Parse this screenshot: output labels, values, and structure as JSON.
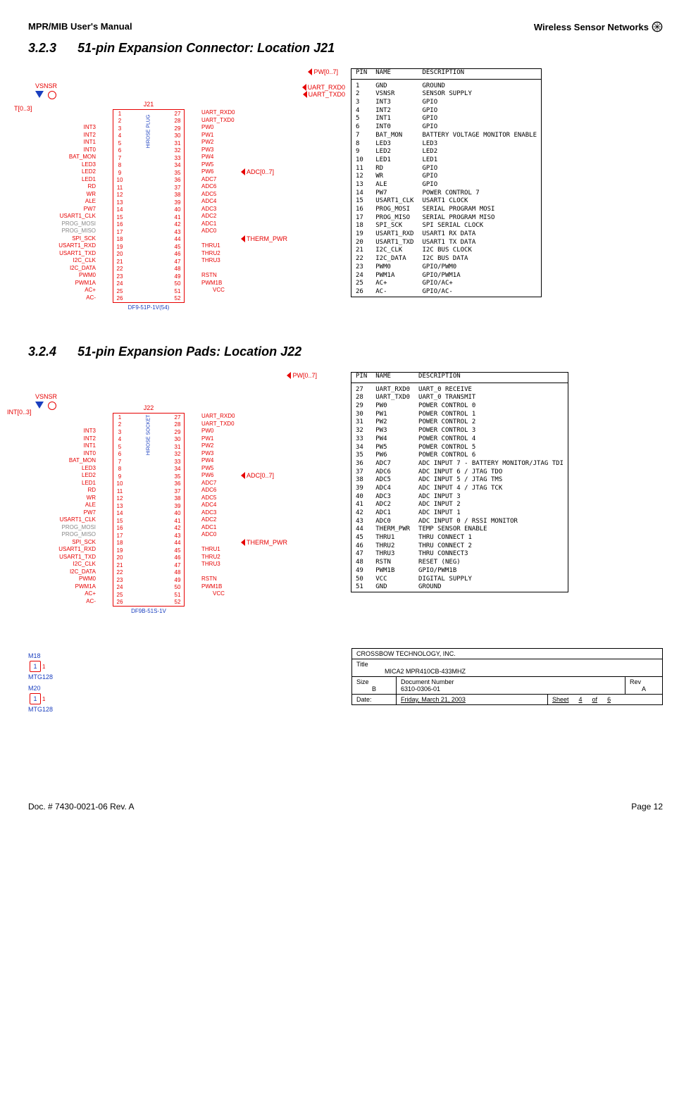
{
  "header": {
    "left": "MPR/MIB User's Manual",
    "right": "Wireless Sensor Networks"
  },
  "sections": {
    "s1": {
      "num": "3.2.3",
      "title": "51-pin Expansion Connector: Location J21"
    },
    "s2": {
      "num": "3.2.4",
      "title": "51-pin Expansion Pads: Location J22"
    }
  },
  "conn1": {
    "ref": "J21",
    "part": "DF9-51P-1V(54)",
    "mid_label": "HIROSE  PLUG",
    "vsnsr": "VSNSR",
    "left_bus": "T[0..3]",
    "top_bus": "PW[0..7]",
    "right_bus": "ADC[0..7]",
    "uart_rx": "UART_RXD0",
    "uart_tx": "UART_TXD0",
    "vcc": "VCC",
    "left": [
      "",
      "",
      "INT3",
      "INT2",
      "INT1",
      "INT0",
      "BAT_MON",
      "LED3",
      "LED2",
      "LED1",
      "RD",
      "WR",
      "ALE",
      "PW7",
      "USART1_CLK",
      "PROG_MOSI",
      "PROG_MISO",
      "SPI_SCK",
      "USART1_RXD",
      "USART1_TXD",
      "I2C_CLK",
      "I2C_DATA",
      "PWM0",
      "PWM1A",
      "AC+",
      "AC-"
    ],
    "right": [
      "UART_RXD0",
      "UART_TXD0",
      "PW0",
      "PW1",
      "PW2",
      "PW3",
      "PW4",
      "PW5",
      "PW6",
      "ADC7",
      "ADC6",
      "ADC5",
      "ADC4",
      "ADC3",
      "ADC2",
      "ADC1",
      "ADC0",
      "",
      "THRU1",
      "THRU2",
      "THRU3",
      "",
      "RSTN",
      "PWM1B",
      ""
    ],
    "therm": "THERM_PWR"
  },
  "conn2": {
    "ref": "J22",
    "part": "DF9B-51S-1V",
    "mid_label": "HIROSE  SOCKET",
    "vsnsr": "VSNSR",
    "left_bus": "INT[0..3]",
    "top_bus": "PW[0..7]",
    "right_bus": "ADC[0..7]",
    "uart_rx": "UART_RXD0",
    "uart_tx": "UART_TXD0",
    "vcc": "VCC",
    "left": [
      "",
      "",
      "INT3",
      "INT2",
      "INT1",
      "INT0",
      "BAT_MON",
      "LED3",
      "LED2",
      "LED1",
      "RD",
      "WR",
      "ALE",
      "PW7",
      "USART1_CLK",
      "PROG_MOSI",
      "PROG_MISO",
      "SPI_SCK",
      "USART1_RXD",
      "USART1_TXD",
      "I2C_CLK",
      "I2C_DATA",
      "PWM0",
      "PWM1A",
      "AC+",
      "AC-"
    ],
    "right": [
      "UART_RXD0",
      "UART_TXD0",
      "PW0",
      "PW1",
      "PW2",
      "PW3",
      "PW4",
      "PW5",
      "PW6",
      "ADC7",
      "ADC6",
      "ADC5",
      "ADC4",
      "ADC3",
      "ADC2",
      "ADC1",
      "ADC0",
      "",
      "THRU1",
      "THRU2",
      "THRU3",
      "",
      "RSTN",
      "PWM1B",
      ""
    ],
    "therm": "THERM_PWR"
  },
  "pins1": {
    "h": [
      "PIN",
      "NAME",
      "DESCRIPTION"
    ],
    "rows": [
      [
        "1",
        "GND",
        "GROUND"
      ],
      [
        "2",
        "VSNSR",
        "SENSOR SUPPLY"
      ],
      [
        "3",
        "INT3",
        "GPIO"
      ],
      [
        "4",
        "INT2",
        "GPIO"
      ],
      [
        "5",
        "INT1",
        "GPIO"
      ],
      [
        "6",
        "INT0",
        "GPIO"
      ],
      [
        "7",
        "BAT_MON",
        "BATTERY VOLTAGE MONITOR ENABLE"
      ],
      [
        "8",
        "LED3",
        "LED3"
      ],
      [
        "9",
        "LED2",
        "LED2"
      ],
      [
        "10",
        "LED1",
        "LED1"
      ],
      [
        "11",
        "RD",
        "GPIO"
      ],
      [
        "12",
        "WR",
        "GPIO"
      ],
      [
        "13",
        "ALE",
        "GPIO"
      ],
      [
        "14",
        "PW7",
        "POWER CONTROL 7"
      ],
      [
        "15",
        "USART1_CLK",
        "USART1  CLOCK"
      ],
      [
        "16",
        "PROG_MOSI",
        "SERIAL PROGRAM MOSI"
      ],
      [
        "17",
        "PROG_MISO",
        "SERIAL PROGRAM MISO"
      ],
      [
        "18",
        "SPI_SCK",
        "SPI SERIAL CLOCK"
      ],
      [
        "19",
        "USART1_RXD",
        "USART1 RX DATA"
      ],
      [
        "20",
        "USART1_TXD",
        "USART1 TX DATA"
      ],
      [
        "21",
        "I2C_CLK",
        "I2C BUS CLOCK"
      ],
      [
        "22",
        "I2C_DATA",
        "I2C BUS DATA"
      ],
      [
        "23",
        "PWM0",
        "GPIO/PWM0"
      ],
      [
        "24",
        "PWM1A",
        "GPIO/PWM1A"
      ],
      [
        "25",
        "AC+",
        "GPIO/AC+"
      ],
      [
        "26",
        "AC-",
        "GPIO/AC-"
      ]
    ]
  },
  "pins2": {
    "h": [
      "PIN",
      "NAME",
      "DESCRIPTION"
    ],
    "rows": [
      [
        "27",
        "UART_RXD0",
        "UART_0 RECEIVE"
      ],
      [
        "28",
        "UART_TXD0",
        "UART_0 TRANSMIT"
      ],
      [
        "29",
        "PW0",
        "POWER CONTROL 0"
      ],
      [
        "30",
        "PW1",
        "POWER CONTROL 1"
      ],
      [
        "31",
        "PW2",
        "POWER CONTROL 2"
      ],
      [
        "32",
        "PW3",
        "POWER CONTROL 3"
      ],
      [
        "33",
        "PW4",
        "POWER CONTROL 4"
      ],
      [
        "34",
        "PW5",
        "POWER CONTROL 5"
      ],
      [
        "35",
        "PW6",
        "POWER CONTROL 6"
      ],
      [
        "36",
        "ADC7",
        "ADC INPUT 7 - BATTERY MONITOR/JTAG TDI"
      ],
      [
        "37",
        "ADC6",
        "ADC INPUT 6 / JTAG TDO"
      ],
      [
        "38",
        "ADC5",
        "ADC INPUT 5 / JTAG TMS"
      ],
      [
        "39",
        "ADC4",
        "ADC INPUT 4 / JTAG TCK"
      ],
      [
        "40",
        "ADC3",
        "ADC INPUT 3"
      ],
      [
        "41",
        "ADC2",
        "ADC INPUT 2"
      ],
      [
        "42",
        "ADC1",
        "ADC INPUT 1"
      ],
      [
        "43",
        "ADC0",
        "ADC INPUT 0 / RSSI MONITOR"
      ],
      [
        "44",
        "THERM_PWR",
        "TEMP SENSOR ENABLE"
      ],
      [
        "45",
        "THRU1",
        "THRU CONNECT 1"
      ],
      [
        "46",
        "THRU2",
        "THRU CONNECT 2"
      ],
      [
        "47",
        "THRU3",
        "THRU CONNECT3"
      ],
      [
        "48",
        "RSTN",
        "RESET (NEG)"
      ],
      [
        "49",
        "PWM1B",
        "GPIO/PWM1B"
      ],
      [
        "50",
        "VCC",
        "DIGITAL SUPPLY"
      ],
      [
        "51",
        "GND",
        "GROUND"
      ]
    ]
  },
  "mtg": [
    {
      "ref": "M18",
      "part": "MTG128"
    },
    {
      "ref": "M20",
      "part": "MTG128"
    }
  ],
  "titleblock": {
    "company": "CROSSBOW TECHNOLOGY, INC.",
    "title_h": "Title",
    "title": "MICA2 MPR410CB-433MHZ",
    "size_h": "Size",
    "size": "B",
    "doc_h": "Document Number",
    "doc": "6310-0306-01",
    "rev_h": "Rev",
    "rev": "A",
    "date_h": "Date:",
    "date": "Friday, March 21, 2003",
    "sheet_h": "Sheet",
    "sheet_n": "4",
    "of": "of",
    "sheet_t": "6"
  },
  "footer": {
    "left": "Doc. # 7430-0021-06 Rev. A",
    "right": "Page 12"
  }
}
